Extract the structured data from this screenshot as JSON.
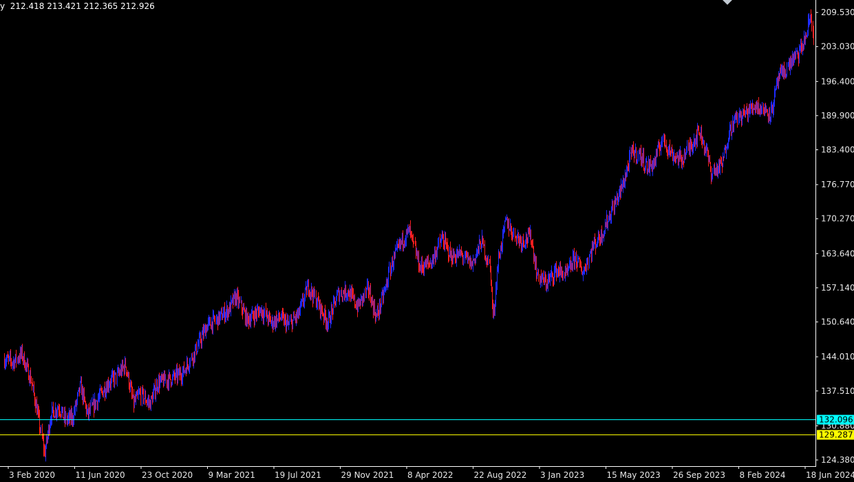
{
  "header": {
    "symbol_tail": "y",
    "ohlc": [
      "212.418",
      "213.421",
      "212.365",
      "212.926"
    ]
  },
  "chart_data": {
    "type": "ohlc",
    "y_ticks": [
      124.38,
      130.88,
      137.51,
      144.01,
      150.64,
      157.14,
      163.64,
      170.27,
      176.77,
      183.4,
      189.9,
      196.4,
      203.03,
      209.53
    ],
    "y_tick_labels": [
      "124.380",
      "130.880",
      "137.510",
      "144.010",
      "150.640",
      "157.140",
      "163.640",
      "170.270",
      "176.770",
      "183.400",
      "189.900",
      "196.400",
      "203.030",
      "209.530"
    ],
    "ylim": [
      123.2,
      211.9
    ],
    "x_tick_labels": [
      "3 Feb 2020",
      "11 Jun 2020",
      "23 Oct 2020",
      "9 Mar 2021",
      "19 Jul 2021",
      "29 Nov 2021",
      "8 Apr 2022",
      "22 Aug 2022",
      "3 Jan 2023",
      "15 May 2023",
      "26 Sep 2023",
      "8 Feb 2024",
      "18 Jun 2024"
    ],
    "price_path": [
      [
        "2020-01-01",
        143.5
      ],
      [
        "2020-01-20",
        143.0
      ],
      [
        "2020-02-05",
        144.6
      ],
      [
        "2020-02-25",
        139.5
      ],
      [
        "2020-03-10",
        133.0
      ],
      [
        "2020-03-23",
        125.5
      ],
      [
        "2020-04-05",
        133.0
      ],
      [
        "2020-04-22",
        134.5
      ],
      [
        "2020-05-05",
        132.0
      ],
      [
        "2020-05-20",
        132.5
      ],
      [
        "2020-06-05",
        138.5
      ],
      [
        "2020-06-20",
        133.0
      ],
      [
        "2020-07-10",
        136.0
      ],
      [
        "2020-08-01",
        139.0
      ],
      [
        "2020-08-20",
        140.5
      ],
      [
        "2020-09-05",
        142.5
      ],
      [
        "2020-09-22",
        135.0
      ],
      [
        "2020-10-05",
        137.0
      ],
      [
        "2020-10-25",
        135.0
      ],
      [
        "2020-11-10",
        139.0
      ],
      [
        "2020-12-10",
        140.0
      ],
      [
        "2021-01-01",
        141.0
      ],
      [
        "2021-01-25",
        145.0
      ],
      [
        "2021-02-20",
        150.0
      ],
      [
        "2021-03-10",
        151.0
      ],
      [
        "2021-04-05",
        153.0
      ],
      [
        "2021-04-20",
        155.5
      ],
      [
        "2021-05-12",
        151.0
      ],
      [
        "2021-06-10",
        153.0
      ],
      [
        "2021-07-01",
        150.5
      ],
      [
        "2021-07-20",
        151.5
      ],
      [
        "2021-08-05",
        150.0
      ],
      [
        "2021-08-25",
        152.0
      ],
      [
        "2021-09-15",
        157.5
      ],
      [
        "2021-10-05",
        154.0
      ],
      [
        "2021-10-25",
        150.5
      ],
      [
        "2021-11-15",
        156.0
      ],
      [
        "2021-12-05",
        156.5
      ],
      [
        "2021-12-25",
        153.5
      ],
      [
        "2022-01-15",
        157.0
      ],
      [
        "2022-02-01",
        151.5
      ],
      [
        "2022-02-20",
        157.0
      ],
      [
        "2022-03-05",
        162.0
      ],
      [
        "2022-03-25",
        166.0
      ],
      [
        "2022-04-10",
        168.0
      ],
      [
        "2022-05-01",
        161.0
      ],
      [
        "2022-05-25",
        162.0
      ],
      [
        "2022-06-15",
        166.5
      ],
      [
        "2022-07-05",
        163.0
      ],
      [
        "2022-07-25",
        163.5
      ],
      [
        "2022-08-15",
        161.5
      ],
      [
        "2022-09-05",
        166.0
      ],
      [
        "2022-09-22",
        161.0
      ],
      [
        "2022-09-28",
        151.0
      ],
      [
        "2022-10-08",
        162.0
      ],
      [
        "2022-10-25",
        170.0
      ],
      [
        "2022-11-05",
        168.0
      ],
      [
        "2022-11-25",
        166.0
      ],
      [
        "2022-12-15",
        167.0
      ],
      [
        "2022-12-28",
        159.5
      ],
      [
        "2023-01-15",
        158.0
      ],
      [
        "2023-02-05",
        160.5
      ],
      [
        "2023-02-25",
        159.5
      ],
      [
        "2023-03-15",
        163.0
      ],
      [
        "2023-04-01",
        160.0
      ],
      [
        "2023-04-20",
        165.0
      ],
      [
        "2023-05-10",
        167.5
      ],
      [
        "2023-05-30",
        172.0
      ],
      [
        "2023-06-20",
        176.5
      ],
      [
        "2023-07-10",
        183.0
      ],
      [
        "2023-07-25",
        182.5
      ],
      [
        "2023-08-10",
        180.0
      ],
      [
        "2023-08-25",
        181.0
      ],
      [
        "2023-09-10",
        185.5
      ],
      [
        "2023-09-30",
        182.5
      ],
      [
        "2023-10-20",
        181.5
      ],
      [
        "2023-11-05",
        184.0
      ],
      [
        "2023-11-25",
        187.0
      ],
      [
        "2023-12-10",
        183.0
      ],
      [
        "2023-12-20",
        179.0
      ],
      [
        "2024-01-10",
        180.5
      ],
      [
        "2024-01-25",
        187.0
      ],
      [
        "2024-02-10",
        189.5
      ],
      [
        "2024-03-01",
        190.5
      ],
      [
        "2024-03-20",
        192.0
      ],
      [
        "2024-04-05",
        191.0
      ],
      [
        "2024-04-20",
        190.5
      ],
      [
        "2024-05-05",
        197.0
      ],
      [
        "2024-05-20",
        198.5
      ],
      [
        "2024-06-05",
        201.0
      ],
      [
        "2024-06-15",
        201.5
      ],
      [
        "2024-07-01",
        205.0
      ],
      [
        "2024-07-10",
        209.0
      ],
      [
        "2024-07-16",
        204.5
      ]
    ],
    "grid": false,
    "colors": {
      "up_bar": "#1f2bff",
      "down_bar": "#ff1f1f",
      "background": "#000000",
      "axis": "#ffffff",
      "text": "#e6e6e6"
    },
    "hlines": [
      {
        "value": 132.096,
        "label": "132.096",
        "color": "#00ffff"
      },
      {
        "value": 129.287,
        "label": "129.287",
        "color": "#ffff00"
      }
    ]
  }
}
